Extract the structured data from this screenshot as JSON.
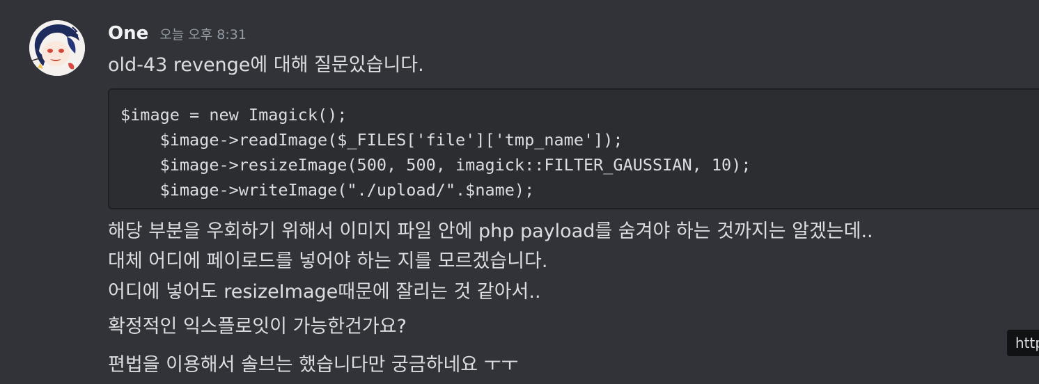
{
  "message": {
    "author": "One",
    "timestamp": "오늘 오후 8:31",
    "lines": [
      "old-43 revenge에 대해 질문있습니다.",
      "해당 부분을 우회하기 위해서 이미지 파일 안에 php payload를 숨겨야 하는 것까지는 알겠는데..",
      "대체 어디에 페이로드를 넣어야 하는 지를 모르겠습니다.",
      "어디에 넣어도 resizeImage때문에 잘리는 것 같아서..",
      "확정적인 익스플로잇이 가능한건가요?",
      "편법을 이용해서 솔브는 했습니다만 궁금하네요 ㅜㅜ"
    ],
    "code": [
      "$image = new Imagick();",
      "    $image->readImage($_FILES['file']['tmp_name']);",
      "    $image->resizeImage(500, 500, imagick::FILTER_GAUSSIAN, 10);",
      "    $image->writeImage(\"./upload/\".$name);"
    ]
  },
  "tooltip": {
    "text": "http"
  },
  "colors": {
    "background": "#313338",
    "code_background": "#2b2d31",
    "text": "#dbdee1",
    "username": "#f2f3f5",
    "timestamp": "#949ba4"
  },
  "icons": {
    "avatar": "anime-character-avatar"
  }
}
